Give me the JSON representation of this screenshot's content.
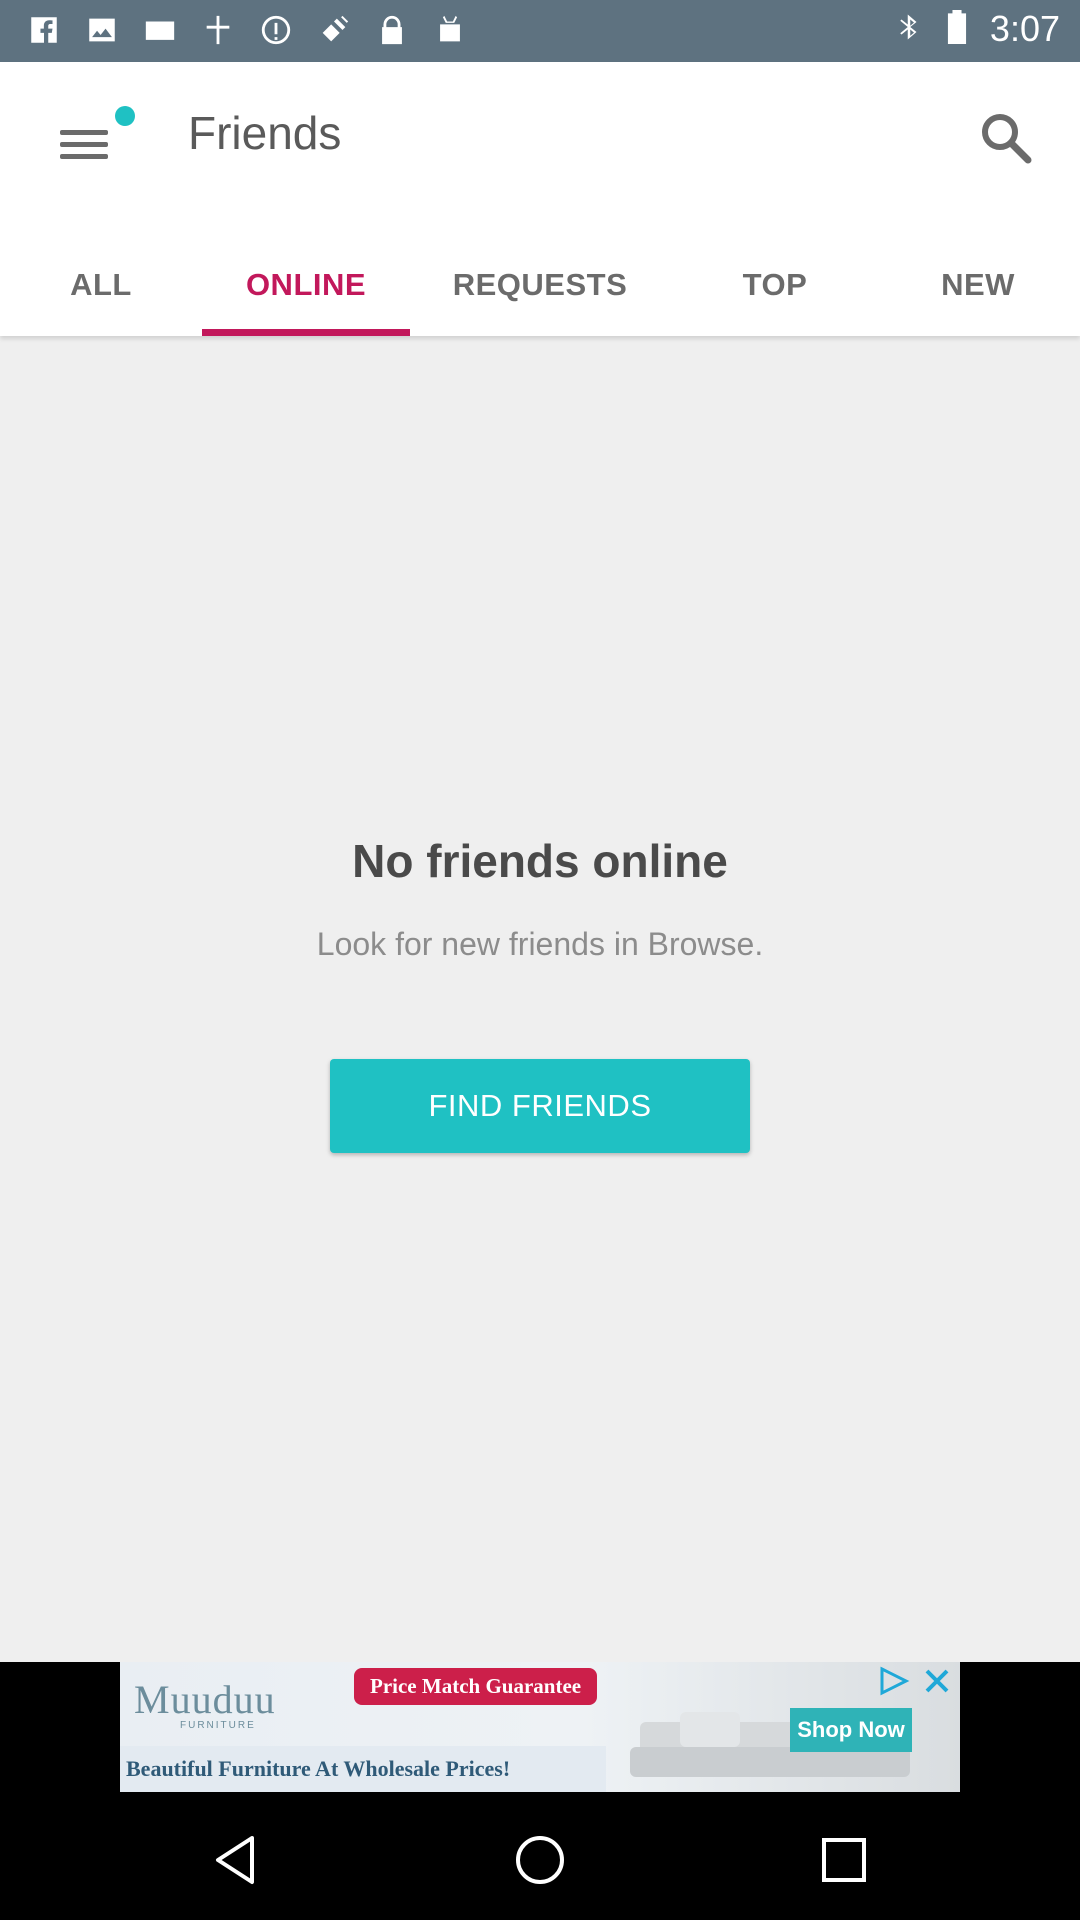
{
  "status_bar": {
    "time": "3:07",
    "left_icons": [
      "facebook-icon",
      "image-icon",
      "mail-icon",
      "satellite-icon",
      "info-icon",
      "fake-gps-icon",
      "lock-icon",
      "robot-icon"
    ],
    "right_icons": [
      "bluetooth-icon",
      "battery-icon"
    ]
  },
  "app_bar": {
    "title": "Friends",
    "accent_color": "#1fc1c3"
  },
  "tabs": [
    {
      "label": "ALL"
    },
    {
      "label": "ONLINE"
    },
    {
      "label": "REQUESTS"
    },
    {
      "label": "TOP"
    },
    {
      "label": "NEW"
    }
  ],
  "active_tab": "ONLINE",
  "active_color": "#c2185b",
  "empty_state": {
    "title": "No friends online",
    "subtitle": "Look for new friends in Browse.",
    "button_label": "FIND FRIENDS"
  },
  "ad": {
    "brand": "Muuduu",
    "brand_sub": "FURNITURE",
    "badge": "Price Match Guarantee",
    "tagline": "Beautiful Furniture At Wholesale Prices!",
    "cta": "Shop Now"
  },
  "nav_bar": {
    "buttons": [
      "back-icon",
      "home-icon",
      "recents-icon"
    ]
  }
}
